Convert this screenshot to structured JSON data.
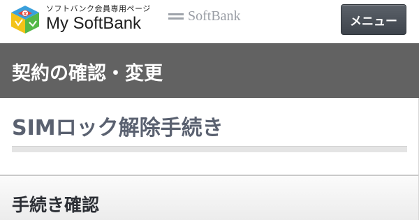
{
  "header": {
    "logo": {
      "tagline": "ソフトバンク会員専用ページ",
      "title": "My SoftBank",
      "icon": "yen-block-logo-icon",
      "colors": [
        "#e8463a",
        "#f3c319",
        "#3aa0dc",
        "#54b848"
      ]
    },
    "brand": {
      "name": "SoftBank",
      "icon": "softbank-bars-icon",
      "color": "#9ea3aa"
    },
    "menu_label": "メニュー"
  },
  "section": {
    "title": "契約の確認・変更",
    "background": "#626262"
  },
  "main": {
    "heading": "SIMロック解除手続き"
  },
  "subsection": {
    "title": "手続き確認"
  }
}
